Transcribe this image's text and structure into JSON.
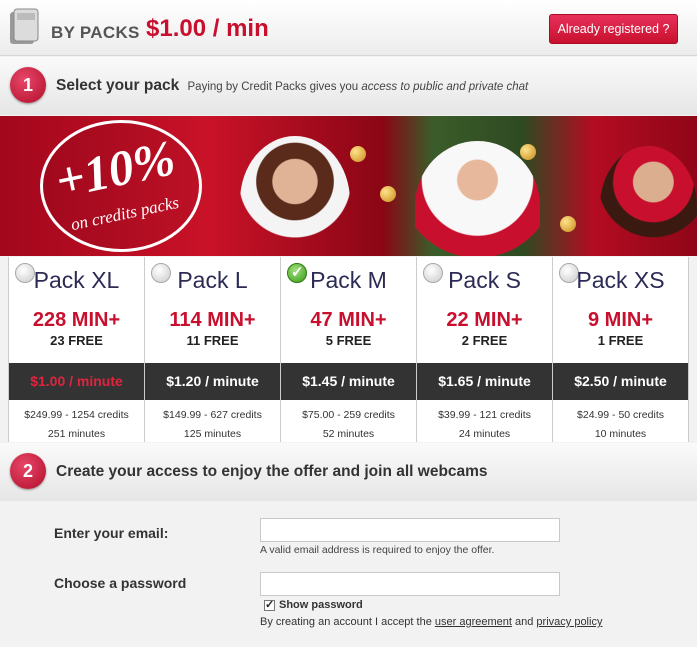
{
  "header": {
    "title": "BY PACKS",
    "price": "$1.00 / min",
    "registered_button": "Already registered ?"
  },
  "step1": {
    "number": "1",
    "title": "Select your pack",
    "subtitle_prefix": "Paying by Credit Packs gives you",
    "subtitle_emphasis": "access to public and private chat"
  },
  "banner": {
    "promo_big": "+10%",
    "promo_small": "on credits packs"
  },
  "packs": [
    {
      "name": "Pack XL",
      "mins": "228 MIN+",
      "free": "23 FREE",
      "rate": "$1.00 / minute",
      "credits": "$249.99 - 1254 credits",
      "minutes": "251 minutes",
      "selected": false
    },
    {
      "name": "Pack L",
      "mins": "114 MIN+",
      "free": "11 FREE",
      "rate": "$1.20 / minute",
      "credits": "$149.99 - 627 credits",
      "minutes": "125 minutes",
      "selected": false
    },
    {
      "name": "Pack M",
      "mins": "47 MIN+",
      "free": "5 FREE",
      "rate": "$1.45 / minute",
      "credits": "$75.00 - 259 credits",
      "minutes": "52 minutes",
      "selected": true
    },
    {
      "name": "Pack S",
      "mins": "22 MIN+",
      "free": "2 FREE",
      "rate": "$1.65 / minute",
      "credits": "$39.99 - 121 credits",
      "minutes": "24 minutes",
      "selected": false
    },
    {
      "name": "Pack XS",
      "mins": "9 MIN+",
      "free": "1 FREE",
      "rate": "$2.50 / minute",
      "credits": "$24.99 - 50 credits",
      "minutes": "10 minutes",
      "selected": false
    }
  ],
  "step2": {
    "number": "2",
    "title": "Create your access to enjoy the offer and join all webcams"
  },
  "form": {
    "email_label": "Enter your email:",
    "email_value": "",
    "email_hint": "A valid email address is required to enjoy the offer.",
    "password_label": "Choose a password",
    "password_value": "",
    "show_password_label": "Show password",
    "show_password_checked": true,
    "agree_prefix": "By creating an account I accept the",
    "user_agreement": "user agreement",
    "agree_and": "and",
    "privacy_policy": "privacy policy"
  },
  "colors": {
    "accent": "#c8102e",
    "rate_bar": "#333333"
  }
}
